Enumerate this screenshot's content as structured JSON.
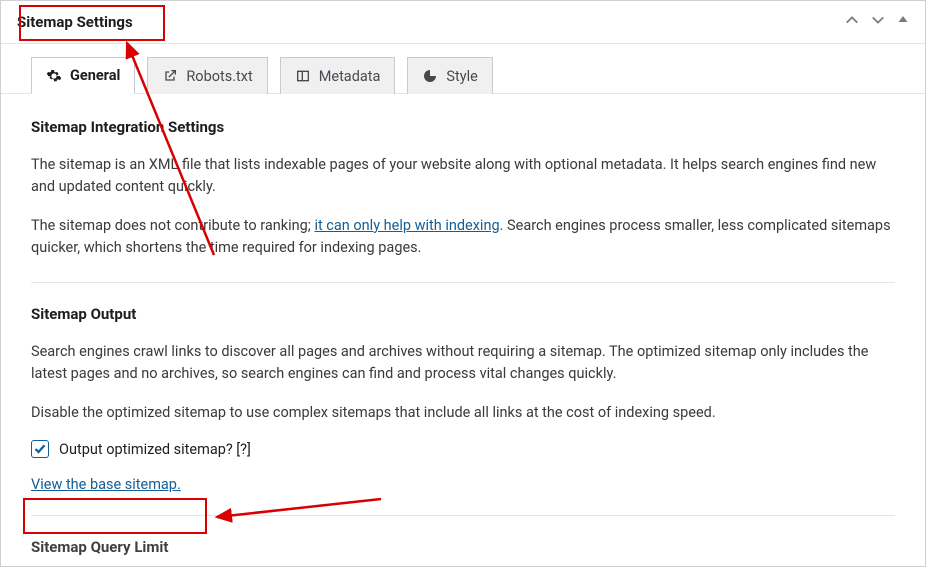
{
  "header": {
    "title": "Sitemap Settings"
  },
  "tabs": [
    {
      "label": "General",
      "icon": "gear-icon"
    },
    {
      "label": "Robots.txt",
      "icon": "export-icon"
    },
    {
      "label": "Metadata",
      "icon": "columns-icon"
    },
    {
      "label": "Style",
      "icon": "partial-circle-icon"
    }
  ],
  "sections": {
    "integration": {
      "title": "Sitemap Integration Settings",
      "p1": "The sitemap is an XML file that lists indexable pages of your website along with optional metadata. It helps search engines find new and updated content quickly.",
      "p2a": "The sitemap does not contribute to ranking; ",
      "p2link": "it can only help with indexing",
      "p2b": ". Search engines process smaller, less complicated sitemaps quicker, which shortens the time required for indexing pages."
    },
    "output": {
      "title": "Sitemap Output",
      "p1": "Search engines crawl links to discover all pages and archives without requiring a sitemap. The optimized sitemap only includes the latest pages and no archives, so search engines can find and process vital changes quickly.",
      "p2": "Disable the optimized sitemap to use complex sitemaps that include all links at the cost of indexing speed.",
      "checkbox_label": "Output optimized sitemap? [?]",
      "link": "View the base sitemap."
    },
    "query": {
      "title": "Sitemap Query Limit"
    }
  }
}
